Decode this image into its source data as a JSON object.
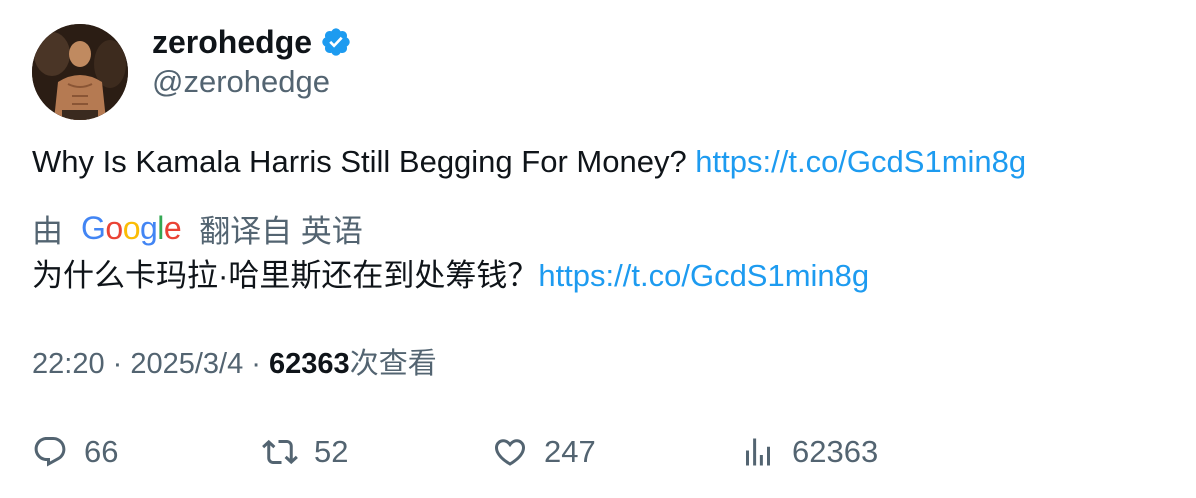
{
  "author": {
    "display_name": "zerohedge",
    "handle": "@zerohedge",
    "verified_badge_icon": "verified-badge-icon",
    "badge_color": "#1d9bf0"
  },
  "tweet": {
    "text": "Why Is Kamala Harris Still Begging For Money? ",
    "link": "https://t.co/GcdS1min8g"
  },
  "translation": {
    "prefix": "由",
    "provider_logo": "Google",
    "suffix": "翻译自 英语",
    "text": "为什么卡玛拉·哈里斯还在到处筹钱？",
    "link": "https://t.co/GcdS1min8g"
  },
  "meta": {
    "time": "22:20",
    "separator": " · ",
    "date": "2025/3/4",
    "views": "62363",
    "views_label": "次查看"
  },
  "actions": {
    "replies": "66",
    "reposts": "52",
    "likes": "247",
    "views": "62363"
  },
  "colors": {
    "link": "#1d9bf0",
    "secondary_text": "#536471",
    "primary_text": "#0f1419"
  }
}
